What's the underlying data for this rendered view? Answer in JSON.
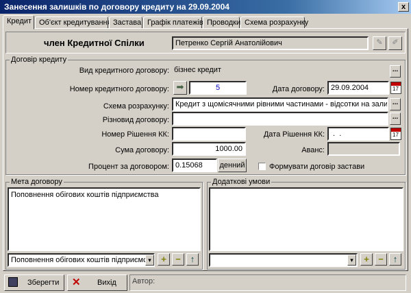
{
  "window": {
    "title": "Занесення залишків по договору кредиту на 29.09.2004",
    "close": "x"
  },
  "tabs": [
    "Кредит",
    "Об'єкт кредитування",
    "Застава",
    "Графік платежів",
    "Проводки",
    "Схема розрахунку"
  ],
  "member": {
    "label": "член Кредитної Спілки",
    "name": "Петренко Сергій Анатолійович"
  },
  "contract": {
    "group_title": "Договір кредиту",
    "type_label": "Вид кредитного договору:",
    "type_value": "бізнес кредит",
    "number_label": "Номер кредитного договору:",
    "number_value": "5",
    "date_label": "Дата договору:",
    "date_value": "29.09.2004",
    "scheme_label": "Схема розрахунку:",
    "scheme_value": "Кредит з щомісячними рівними частинами - відсотки на залишок",
    "kind_label": "Різновид договору:",
    "kind_value": "",
    "decision_label": "Номер Рішення КК:",
    "decision_value": "",
    "decision_date_label": "Дата Рішення КК:",
    "decision_date_value": " .  .",
    "sum_label": "Сума договору:",
    "sum_value": "1000.00",
    "advance_label": "Аванс:",
    "advance_value": "",
    "rate_label": "Процент за договором:",
    "rate_value": "0.15068",
    "rate_unit": "денний",
    "pledge_checkbox": "Формувати договір застави",
    "pledge_checked": false
  },
  "purpose": {
    "group_title": "Мета договору",
    "text": "Поповнення обігових коштів підприємства",
    "select": "Поповнення обігових коштів підприємства"
  },
  "extra": {
    "group_title": "Додаткові умови",
    "text": "",
    "select": ""
  },
  "buttons": {
    "save": "Зберегти",
    "exit": "Вихід",
    "author_label": "Автор:"
  },
  "icons": {
    "plus": "+",
    "minus": "−",
    "up": "↑",
    "dots": "...",
    "dropdown": "▾",
    "cal_day": "17"
  }
}
